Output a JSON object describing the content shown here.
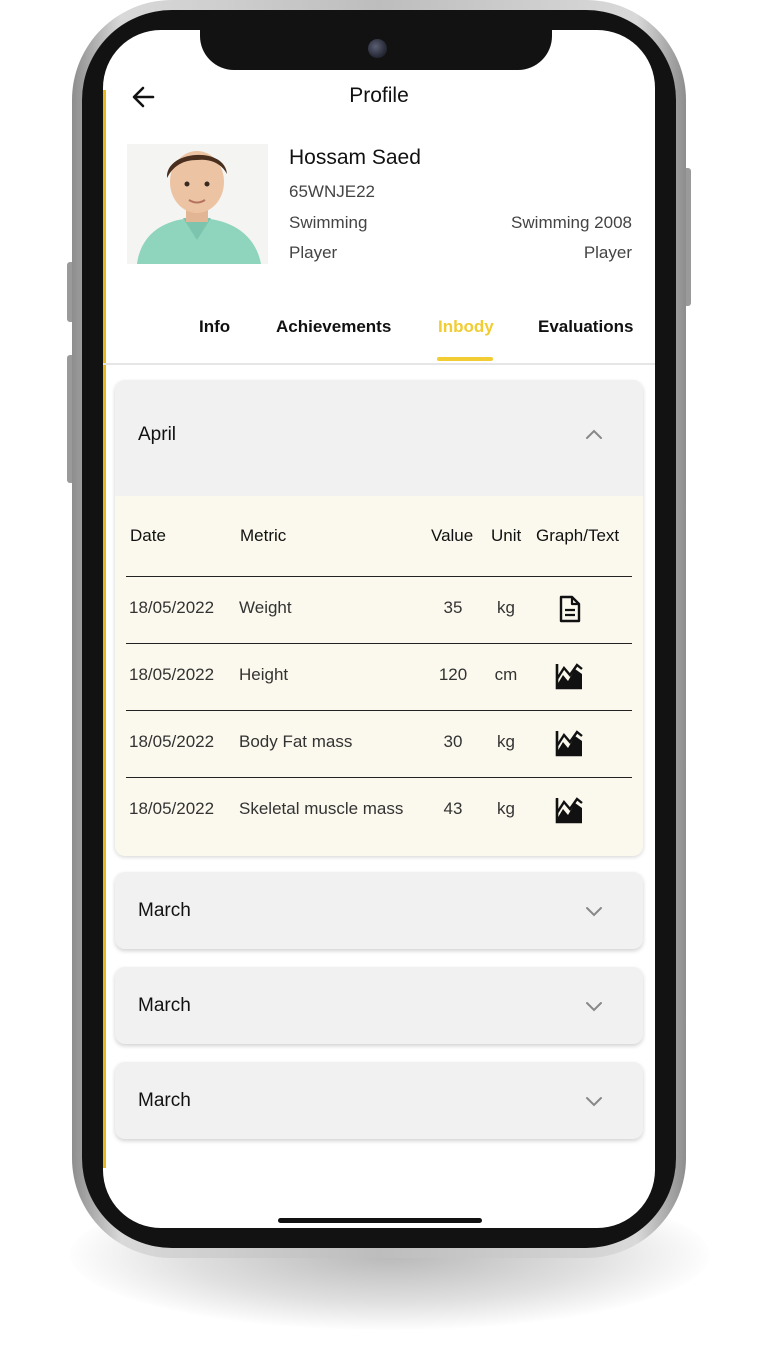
{
  "header": {
    "title": "Profile"
  },
  "profile": {
    "name": "Hossam Saed",
    "code": "65WNJE22",
    "sport": "Swimming",
    "team": "Swimming 2008",
    "role_left": "Player",
    "role_right": "Player"
  },
  "tabs": [
    {
      "label": "Info",
      "active": false
    },
    {
      "label": "Achievements",
      "active": false
    },
    {
      "label": "Inbody",
      "active": true
    },
    {
      "label": "Evaluations",
      "active": false
    }
  ],
  "accordion": [
    {
      "label": "April",
      "expanded": true,
      "columns": [
        "Date",
        "Metric",
        "Value",
        "Unit",
        "Graph/Text"
      ],
      "rows": [
        {
          "date": "18/05/2022",
          "metric": "Weight",
          "value": "35",
          "unit": "kg",
          "icon": "document-icon"
        },
        {
          "date": "18/05/2022",
          "metric": "Height",
          "value": "120",
          "unit": "cm",
          "icon": "chart-icon"
        },
        {
          "date": "18/05/2022",
          "metric": "Body Fat mass",
          "value": "30",
          "unit": "kg",
          "icon": "chart-icon"
        },
        {
          "date": "18/05/2022",
          "metric": "Skeletal muscle mass",
          "value": "43",
          "unit": "kg",
          "icon": "chart-icon"
        }
      ]
    },
    {
      "label": "March",
      "expanded": false
    },
    {
      "label": "March",
      "expanded": false
    },
    {
      "label": "March",
      "expanded": false
    }
  ],
  "colors": {
    "accent": "#f2cc33",
    "table_bg": "#fbf9ed",
    "panel_bg": "#f1f1f1"
  }
}
